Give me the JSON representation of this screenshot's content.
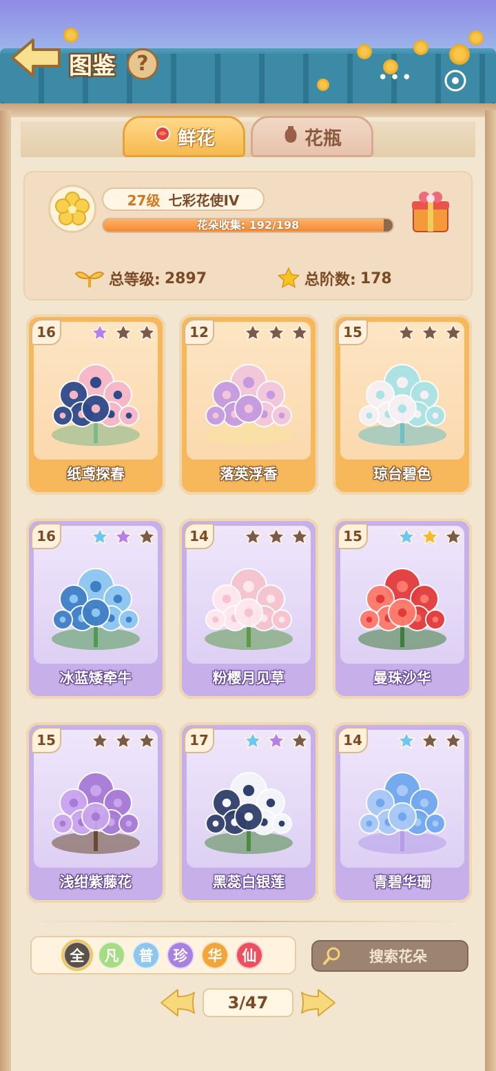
{
  "header": {
    "title": "图鉴",
    "help_label": "?",
    "more_label": "•••"
  },
  "tabs": [
    {
      "label": "鲜花",
      "icon": "rose-icon",
      "active": true
    },
    {
      "label": "花瓶",
      "icon": "vase-icon",
      "active": false
    }
  ],
  "stats": {
    "level": "27级",
    "level_title": "七彩花使IV",
    "collection_label": "花朵收集: 192/198",
    "collection_progress": 0.9697,
    "total_level_label": "总等级:",
    "total_level_value": "2897",
    "total_stars_label": "总阶数:",
    "total_stars_value": "178"
  },
  "cards": [
    {
      "level": "16",
      "name": "纸鸢探春",
      "theme": "orange",
      "stars": [
        "purple",
        "empty",
        "empty"
      ],
      "art": "kite-flower-art"
    },
    {
      "level": "12",
      "name": "落英浮香",
      "theme": "orange",
      "stars": [
        "empty",
        "empty",
        "empty"
      ],
      "art": "swing-flower-art"
    },
    {
      "level": "15",
      "name": "琼台碧色",
      "theme": "orange",
      "stars": [
        "empty",
        "empty",
        "empty"
      ],
      "art": "jade-peony-art"
    },
    {
      "level": "16",
      "name": "冰蓝矮牵牛",
      "theme": "purple",
      "stars": [
        "blue",
        "purple",
        "empty"
      ],
      "art": "petunia-art"
    },
    {
      "level": "14",
      "name": "粉樱月见草",
      "theme": "purple",
      "stars": [
        "empty",
        "empty",
        "empty"
      ],
      "art": "primrose-art"
    },
    {
      "level": "15",
      "name": "曼珠沙华",
      "theme": "purple",
      "stars": [
        "blue",
        "gold",
        "empty"
      ],
      "art": "spider-lily-art"
    },
    {
      "level": "15",
      "name": "浅绀紫藤花",
      "theme": "purple",
      "stars": [
        "empty",
        "empty",
        "empty"
      ],
      "art": "wisteria-art"
    },
    {
      "level": "17",
      "name": "黑蕊白银莲",
      "theme": "purple",
      "stars": [
        "blue",
        "purple",
        "empty"
      ],
      "art": "anemone-art"
    },
    {
      "level": "14",
      "name": "青碧华珊",
      "theme": "purple",
      "stars": [
        "blue",
        "empty",
        "empty"
      ],
      "art": "coral-art"
    }
  ],
  "filters": [
    {
      "label": "全",
      "selected": true
    },
    {
      "label": "凡",
      "selected": false
    },
    {
      "label": "普",
      "selected": false
    },
    {
      "label": "珍",
      "selected": false
    },
    {
      "label": "华",
      "selected": false
    },
    {
      "label": "仙",
      "selected": false
    }
  ],
  "search": {
    "placeholder": "搜索花朵"
  },
  "pagination": {
    "label": "3/47",
    "current": 3,
    "total": 47
  },
  "colors": {
    "star_purple": "#b57ee8",
    "star_blue": "#6cc7f2",
    "star_gold": "#f6b92c",
    "star_empty": "#7a5a48",
    "accent_orange": "#f08a35"
  }
}
